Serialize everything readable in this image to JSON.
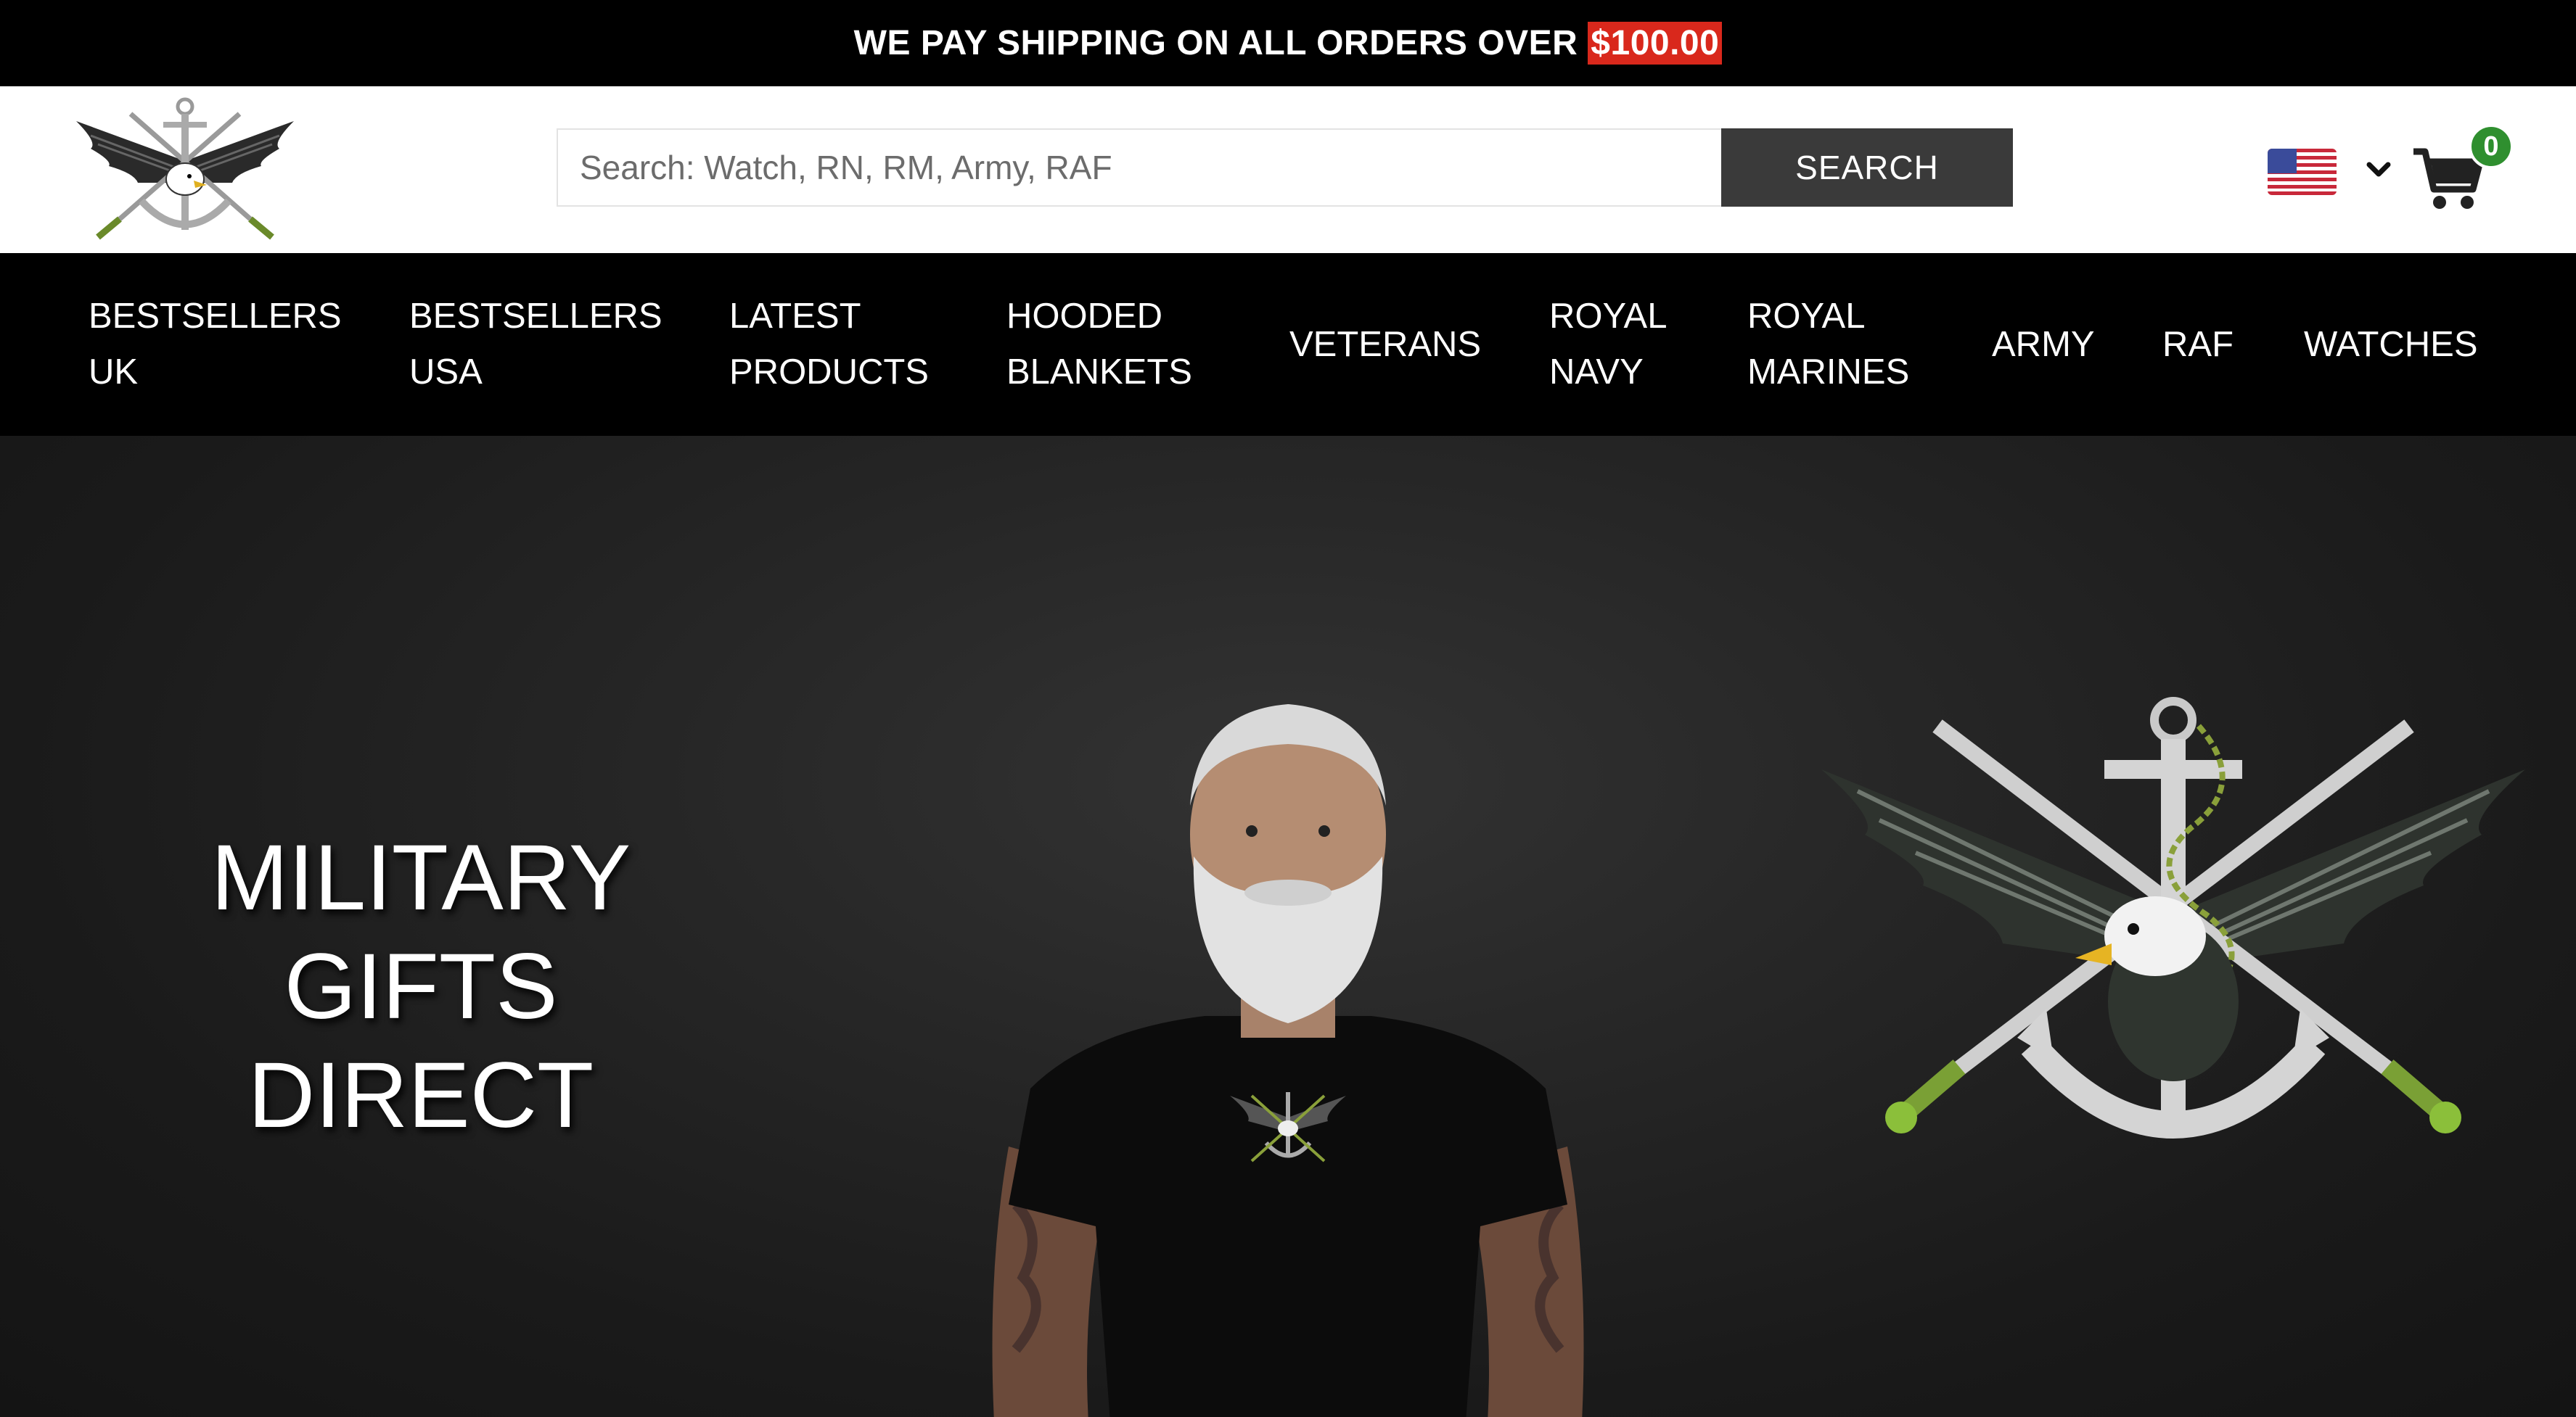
{
  "announcement": {
    "text": "WE PAY SHIPPING ON ALL ORDERS OVER",
    "amount": "$100.00",
    "highlight_color": "#d9281c"
  },
  "header": {
    "logo_icon": "eagle-anchor-swords-emblem",
    "search": {
      "placeholder": "Search: Watch, RN, RM, Army, RAF",
      "value": "",
      "button_label": "SEARCH"
    },
    "currency_icon": "us-flag-icon",
    "cart": {
      "icon": "cart-icon",
      "count": "0",
      "badge_color": "#2f8f2f"
    }
  },
  "nav": {
    "items": [
      {
        "label": "BESTSELLERS\nUK"
      },
      {
        "label": "BESTSELLERS\nUSA"
      },
      {
        "label": "LATEST\nPRODUCTS"
      },
      {
        "label": "HOODED\nBLANKETS"
      },
      {
        "label": "VETERANS"
      },
      {
        "label": "ROYAL\nNAVY"
      },
      {
        "label": "ROYAL\nMARINES"
      },
      {
        "label": "ARMY"
      },
      {
        "label": "RAF"
      },
      {
        "label": "WATCHES"
      }
    ]
  },
  "hero": {
    "title": "MILITARY GIFTS\nDIRECT"
  }
}
